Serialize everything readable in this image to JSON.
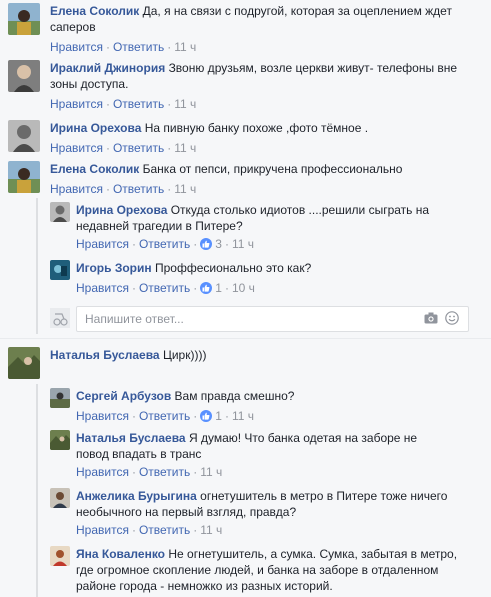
{
  "actions": {
    "like": "Нравится",
    "reply": "Ответить"
  },
  "reply_input": {
    "placeholder": "Напишите ответ..."
  },
  "comments": [
    {
      "author": "Елена Соколик",
      "text_line1": "Да, я на связи с подругой, которая за оцеплением ждет",
      "text_line2": "саперов",
      "time": "11 ч"
    },
    {
      "author": "Ираклий Джинория",
      "text_line1": "Звоню друзьям, возле церкви живут- телефоны вне",
      "text_line2": "зоны доступа.",
      "time": "11 ч"
    },
    {
      "author": "Ирина Орехова",
      "text_line1": "На пивную банку похоже ,фото тёмное .",
      "time": "11 ч"
    },
    {
      "author": "Елена Соколик",
      "text_line1": "Банка от пепси, прикручена профессионально",
      "time": "11 ч"
    },
    {
      "author": "Наталья Буслаева",
      "text_line1": "Цирк))))"
    }
  ],
  "replies_a": [
    {
      "author": "Ирина Орехова",
      "text_line1": "Откуда столько идиотов ....решили сыграть на",
      "text_line2": "недавней трагедии в Питере?",
      "likes": "3",
      "time": "11 ч"
    },
    {
      "author": "Игорь Зорин",
      "text_line1": "Проффесионально это как?",
      "likes": "1",
      "time": "10 ч"
    }
  ],
  "replies_b": [
    {
      "author": "Сергей Арбузов",
      "text_line1": "Вам правда смешно?",
      "likes": "1",
      "time": "11 ч"
    },
    {
      "author": "Наталья Буслаева",
      "text_line1": "Я думаю! Что банка одетая на заборе не",
      "text_line2": "повод впадать в транс",
      "time": "11 ч"
    },
    {
      "author": "Анжелика Бурыгина",
      "text_line1": "огнетушитель в метро в Питере тоже ничего",
      "text_line2": "необычного на первый взгляд, правда?",
      "time": "11 ч"
    },
    {
      "author": "Яна Коваленко",
      "text_line1": "Не огнетушитель, а сумка. Сумка, забытая в метро,",
      "text_line2": "где огромное скопление людей, и банка на заборе в отдаленном",
      "text_line3": "районе города - немножко из разных историй."
    }
  ]
}
